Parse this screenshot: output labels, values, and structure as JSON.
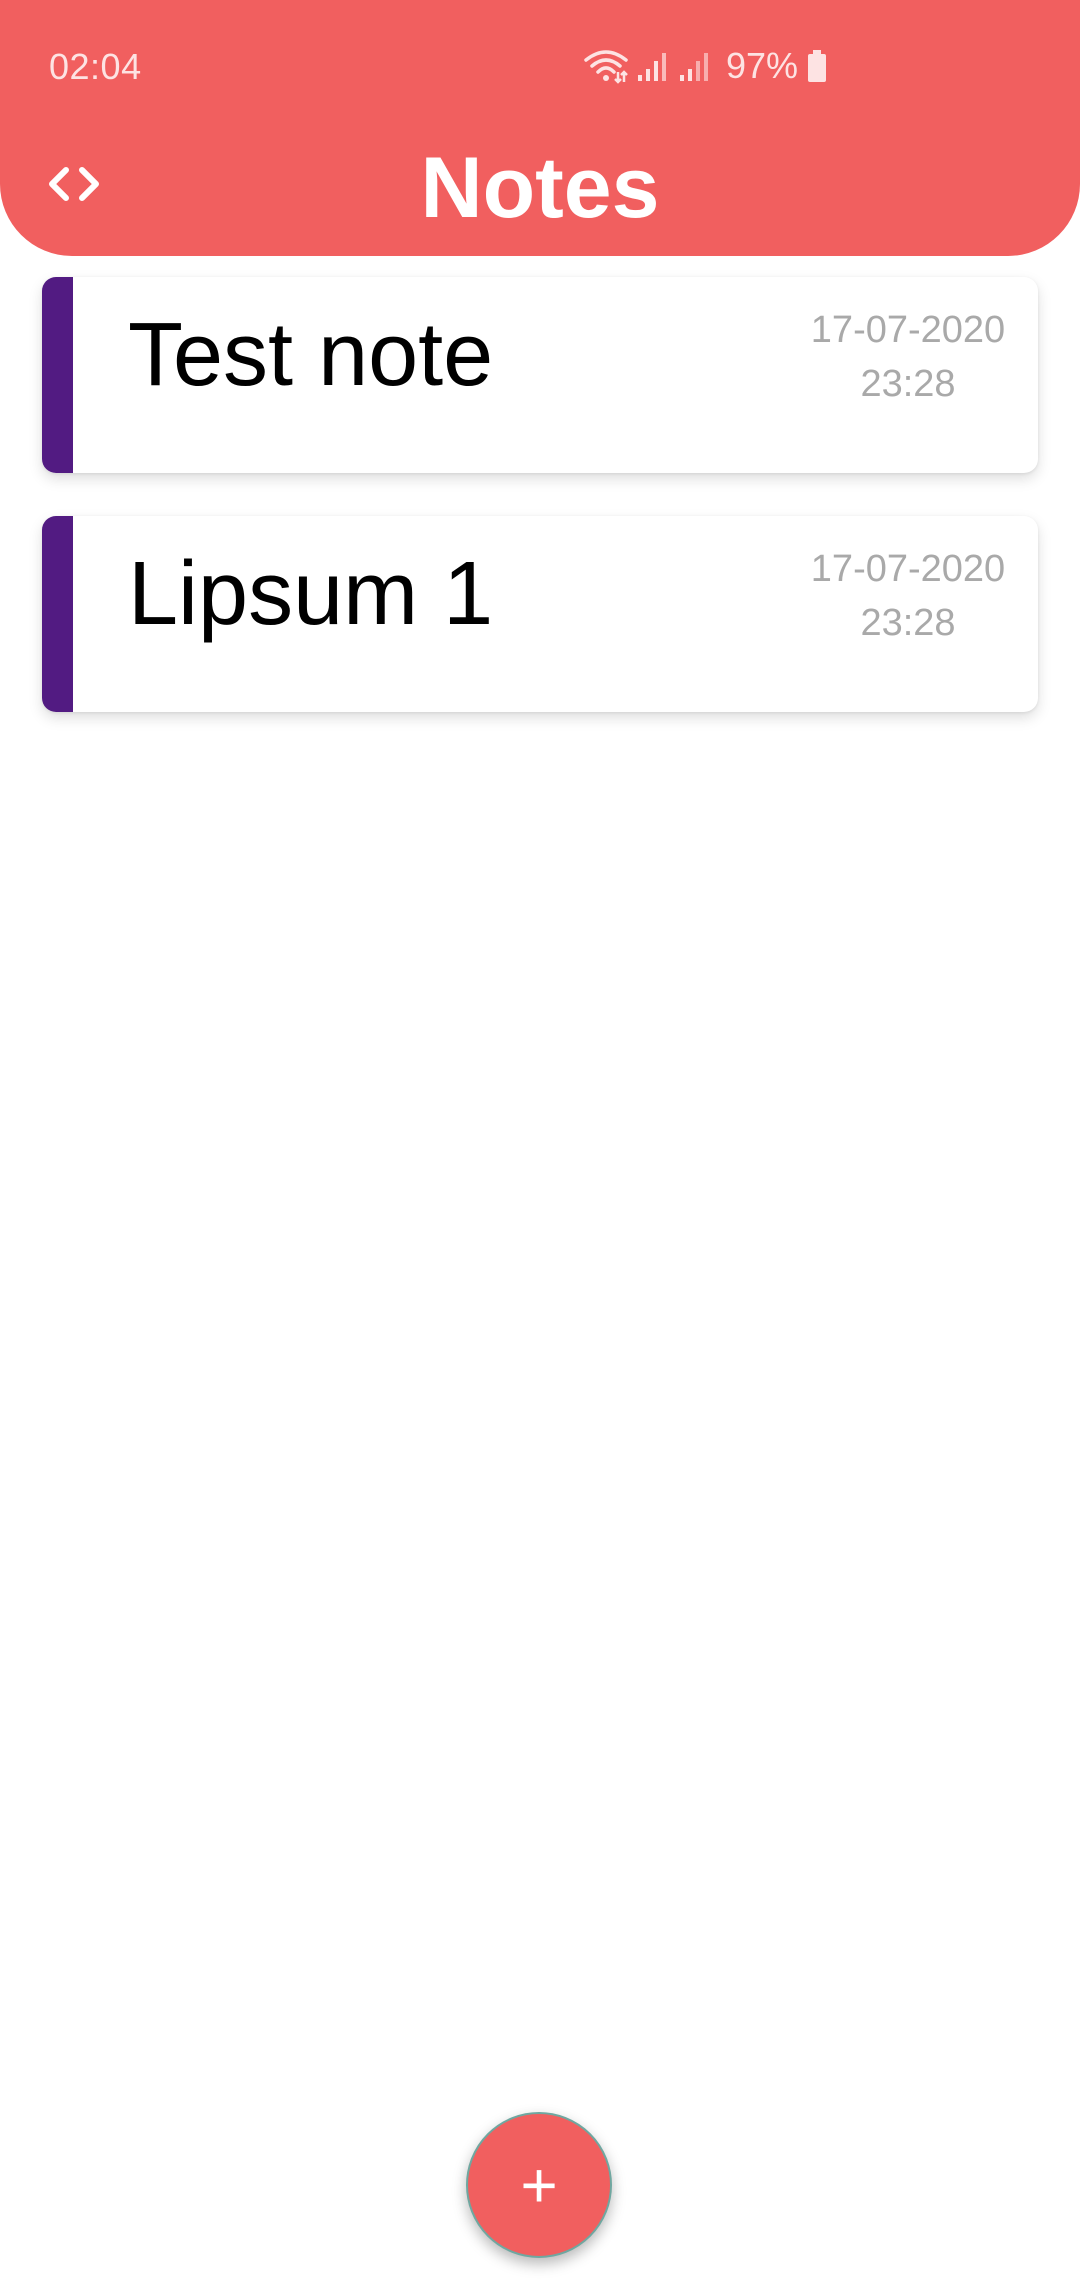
{
  "status_bar": {
    "time": "02:04",
    "battery_percent": "97%",
    "icons": [
      "wifi-icon",
      "signal-icon",
      "signal-icon",
      "battery-icon"
    ]
  },
  "header": {
    "title": "Notes",
    "left_icon": "code-icon",
    "background_color": "#f15f5f"
  },
  "notes": [
    {
      "title": "Test note",
      "date": "17-07-2020",
      "time": "23:28",
      "accent_color": "#521b82"
    },
    {
      "title": "Lipsum 1",
      "date": "17-07-2020",
      "time": "23:28",
      "accent_color": "#521b82"
    }
  ],
  "fab": {
    "icon": "plus-icon",
    "symbol": "+"
  }
}
